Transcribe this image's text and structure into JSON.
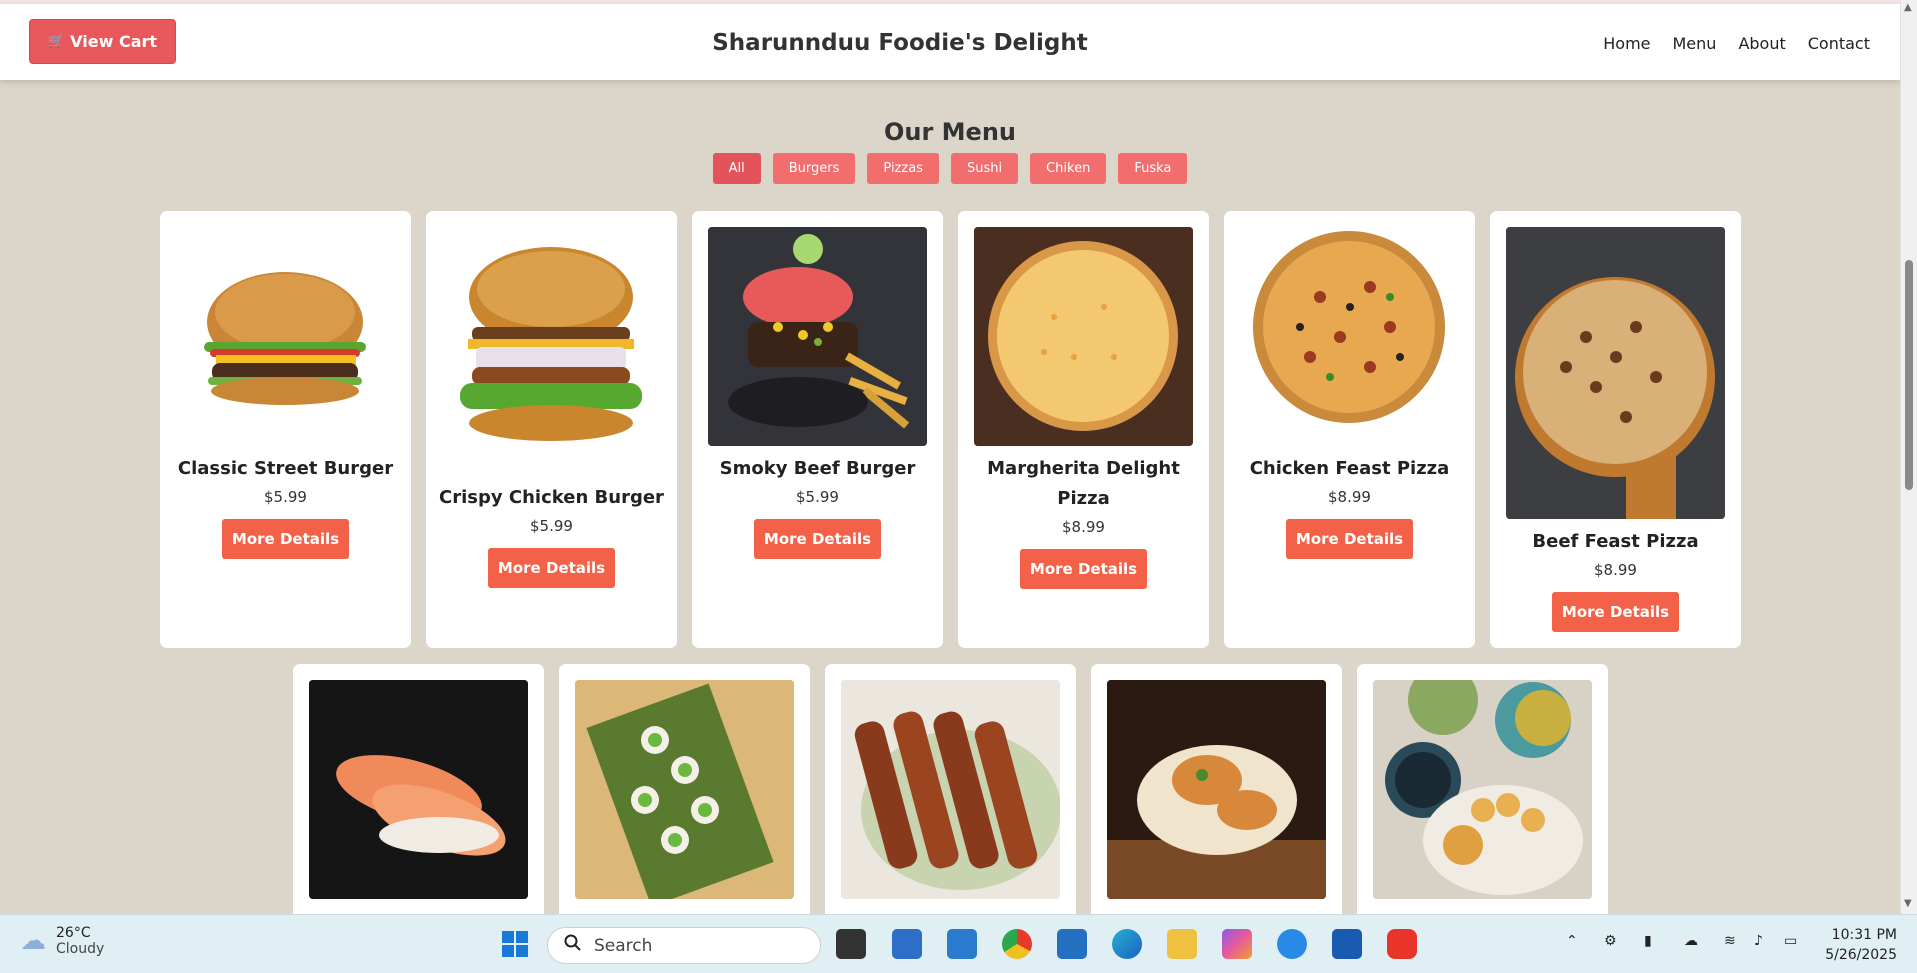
{
  "header": {
    "cart_label": "View Cart",
    "brand": "Sharunnduu Foodie's Delight",
    "nav": [
      "Home",
      "Menu",
      "About",
      "Contact"
    ]
  },
  "menu": {
    "title": "Our Menu",
    "filters": [
      "All",
      "Burgers",
      "Pizzas",
      "Sushi",
      "Chiken",
      "Fuska"
    ],
    "active_filter": "All",
    "row1": [
      {
        "name": "Classic Street Burger",
        "price": "$5.99",
        "button": "More Details"
      },
      {
        "name": "Crispy Chicken Burger",
        "price": "$5.99",
        "button": "More Details"
      },
      {
        "name": "Smoky Beef Burger",
        "price": "$5.99",
        "button": "More Details"
      },
      {
        "name": "Margherita Delight Pizza",
        "price": "$8.99",
        "button": "More Details"
      },
      {
        "name": "Chicken Feast Pizza",
        "price": "$8.99",
        "button": "More Details"
      },
      {
        "name": "Beef Feast Pizza",
        "price": "$8.99",
        "button": "More Details"
      }
    ]
  },
  "taskbar": {
    "temperature": "26°C",
    "condition": "Cloudy",
    "search_placeholder": "Search",
    "time": "10:31 PM",
    "date": "5/26/2025"
  },
  "colors": {
    "accent": "#e8575c",
    "button": "#f26148",
    "background": "#dcd5c9"
  }
}
